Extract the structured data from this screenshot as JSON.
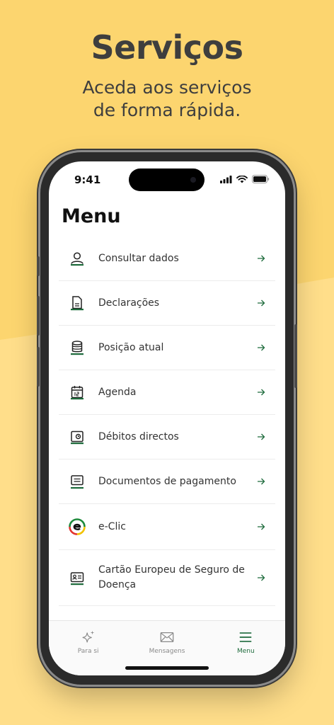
{
  "promo": {
    "title": "Serviços",
    "subtitle_line1": "Aceda aos serviços",
    "subtitle_line2": "de forma rápida."
  },
  "status_bar": {
    "time": "9:41"
  },
  "screen": {
    "title": "Menu",
    "items": [
      {
        "label": "Consultar dados",
        "icon": "user-icon"
      },
      {
        "label": "Declarações",
        "icon": "document-icon"
      },
      {
        "label": "Posição atual",
        "icon": "coins-icon"
      },
      {
        "label": "Agenda",
        "icon": "calendar-icon"
      },
      {
        "label": "Débitos directos",
        "icon": "direct-debit-icon"
      },
      {
        "label": "Documentos de pagamento",
        "icon": "payment-document-icon"
      },
      {
        "label": "e-Clic",
        "icon": "eclic-logo-icon"
      },
      {
        "label": "Cartão Europeu de Seguro de Doença",
        "icon": "id-card-icon"
      }
    ]
  },
  "tab_bar": {
    "tabs": [
      {
        "label": "Para si",
        "icon": "sparkle-icon"
      },
      {
        "label": "Mensagens",
        "icon": "envelope-icon"
      },
      {
        "label": "Menu",
        "icon": "hamburger-icon",
        "active": true
      }
    ]
  },
  "colors": {
    "background": "#fcd56f",
    "accent_green": "#1e6b3c",
    "text_dark": "#3e3e3e"
  }
}
